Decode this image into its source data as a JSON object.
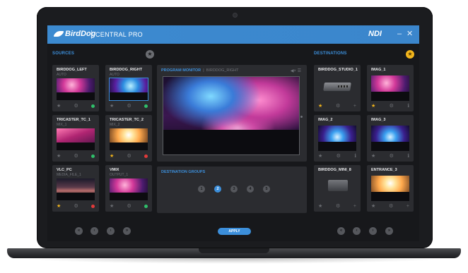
{
  "app": {
    "logo": "BirdDog",
    "product": "CENTRAL PRO",
    "ndi_logo": "NDI",
    "minimize": "–",
    "close": "✕"
  },
  "sources": {
    "label": "SOURCES",
    "tiles": [
      {
        "name": "BIRDDOG_LEFT",
        "sub": "AUTO",
        "status": "#2fc06a",
        "starred": false
      },
      {
        "name": "BIRDDOG_RIGHT",
        "sub": "AUTO",
        "status": "#2fc06a",
        "starred": false
      },
      {
        "name": "TRICASTER_TC_1",
        "sub": "MIX_1",
        "status": "#2fc06a",
        "starred": false
      },
      {
        "name": "TRICASTER_TC_2",
        "sub": "MIX_2",
        "status": "#e23a3a",
        "starred": true
      },
      {
        "name": "VLC_PC",
        "sub": "MEDIA_FILE_1",
        "status": "#e23a3a",
        "starred": true
      },
      {
        "name": "VMIX",
        "sub": "OUTPUT_1",
        "status": "#2fc06a",
        "starred": false
      }
    ]
  },
  "program_monitor": {
    "label": "PROGRAM MONITOR",
    "source": "BIRDDOG_RIGHT",
    "tools": "◀× ☰"
  },
  "destination_groups": {
    "label": "DESTINATION GROUPS",
    "groups": [
      "1",
      "2",
      "3",
      "4",
      "5"
    ],
    "active": "2"
  },
  "destinations": {
    "label": "DESTINATIONS",
    "tiles": [
      {
        "name": "BIRDDOG_STUDIO_1",
        "starred": true
      },
      {
        "name": "IMAG_1",
        "starred": true
      },
      {
        "name": "IMAG_2",
        "starred": false
      },
      {
        "name": "IMAG_3",
        "starred": false
      },
      {
        "name": "BIRDDOG_MINI_8",
        "starred": false
      },
      {
        "name": "ENTRANCE_3",
        "starred": false
      }
    ]
  },
  "nav": {
    "first": "«",
    "prev": "‹",
    "next": "›",
    "last": "»"
  },
  "apply_label": "APPLY",
  "colors": {
    "accent": "#3c8fdb",
    "titlebar": "#3b88ce",
    "star_gold": "#f2b51c",
    "status_green": "#2fc06a",
    "status_red": "#e23a3a"
  },
  "icons": {
    "star": "★",
    "gear": "⚙",
    "plus": "+",
    "info": "ℹ"
  }
}
